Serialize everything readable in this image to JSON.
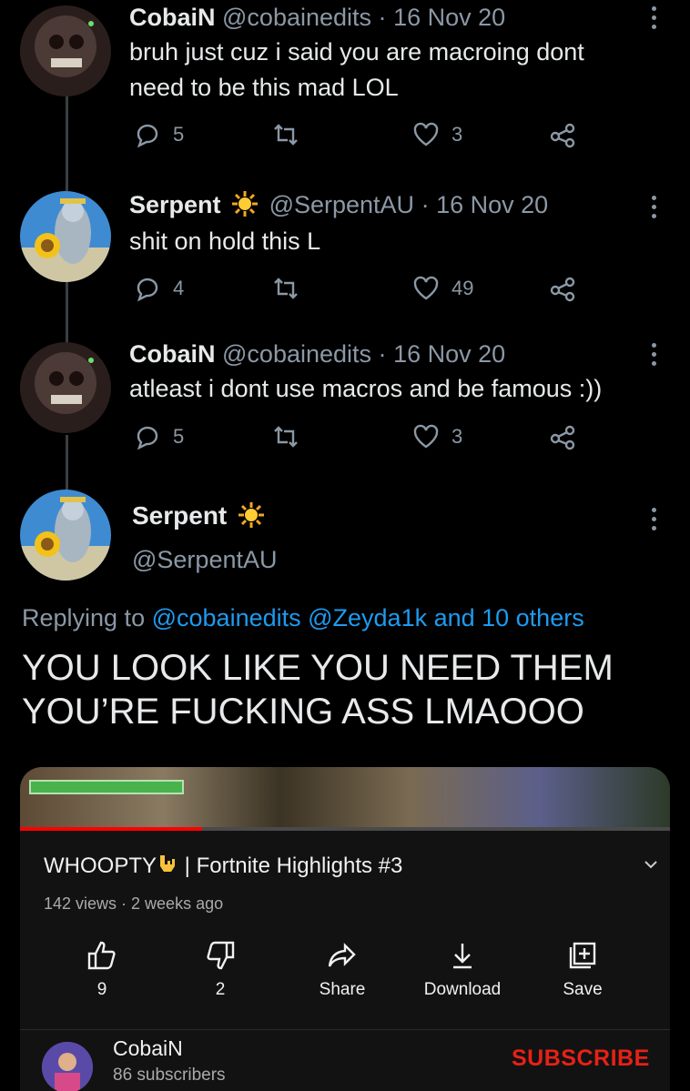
{
  "tweets": [
    {
      "name": "CobaiN",
      "handle": "@cobainedits",
      "date": "16 Nov 20",
      "text_lines": [
        "bruh just cuz i said you are macroing dont",
        "need to be this mad LOL"
      ],
      "replies": "5",
      "likes": "3"
    },
    {
      "name": "Serpent",
      "handle": "@SerpentAU",
      "date": "16 Nov 20",
      "text_lines": [
        "shit on hold this L"
      ],
      "replies": "4",
      "likes": "49"
    },
    {
      "name": "CobaiN",
      "handle": "@cobainedits",
      "date": "16 Nov 20",
      "text_lines": [
        "atleast i dont use macros and be famous :))"
      ],
      "replies": "5",
      "likes": "3"
    }
  ],
  "separator": "·",
  "main_tweet": {
    "name": "Serpent",
    "handle": "@SerpentAU",
    "replying_prefix": "Replying to",
    "replying_to": "@cobainedits @Zeyda1k and 10 others",
    "text_lines": [
      "YOU LOOK LIKE YOU NEED THEM",
      "YOU’RE FUCKING ASS LMAOOO"
    ]
  },
  "video": {
    "title_start": "WHOOPTY",
    "title_rest": " | Fortnite Highlights #3",
    "views": "142 views · 2 weeks ago",
    "progress": 0.28,
    "actions": {
      "like_count": "9",
      "dislike_count": "2",
      "share": "Share",
      "download": "Download",
      "save": "Save"
    },
    "channel": {
      "name": "CobaiN",
      "subscribers": "86 subscribers",
      "subscribe": "SUBSCRIBE"
    }
  },
  "colors": {
    "background": "#000000",
    "text": "#e7e9ea",
    "muted": "#8b98a5",
    "link": "#1d9bf0",
    "youtube_red": "#e62117"
  }
}
